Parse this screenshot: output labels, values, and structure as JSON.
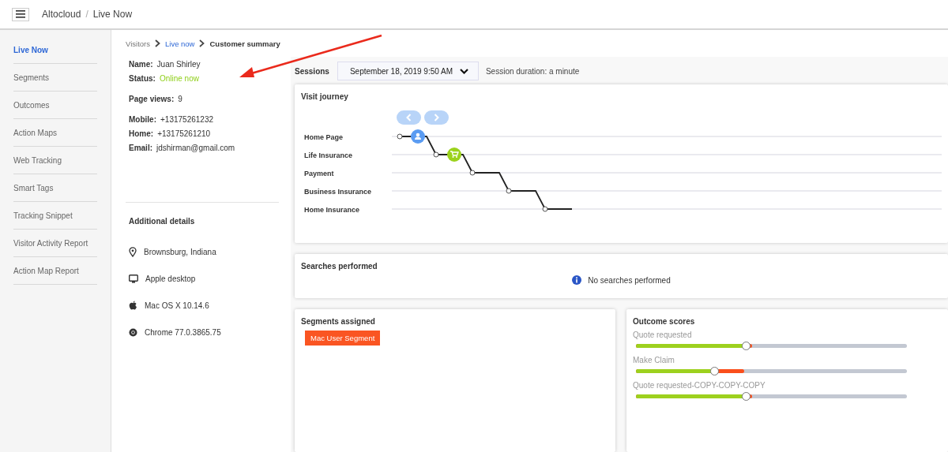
{
  "header": {
    "app": "Altocloud",
    "separator": "/",
    "page": "Live Now"
  },
  "sidebar": {
    "items": [
      {
        "label": "Live Now",
        "selected": true
      },
      {
        "label": "Segments",
        "selected": false
      },
      {
        "label": "Outcomes",
        "selected": false
      },
      {
        "label": "Action Maps",
        "selected": false
      },
      {
        "label": "Web Tracking",
        "selected": false
      },
      {
        "label": "Smart Tags",
        "selected": false
      },
      {
        "label": "Tracking Snippet",
        "selected": false
      },
      {
        "label": "Visitor Activity Report",
        "selected": false
      },
      {
        "label": "Action Map Report",
        "selected": false
      }
    ]
  },
  "breadcrumb": [
    {
      "label": "Visitors",
      "kind": "plain"
    },
    {
      "label": "Live now",
      "kind": "link"
    },
    {
      "label": "Customer summary",
      "kind": "current"
    }
  ],
  "visitor": {
    "groups": [
      [
        {
          "label": "Name:",
          "value": "Juan Shirley",
          "kind": "plain"
        },
        {
          "label": "Status:",
          "value": "Online now",
          "kind": "online"
        }
      ],
      [
        {
          "label": "Page views:",
          "value": "9",
          "kind": "plain"
        }
      ],
      [
        {
          "label": "Mobile:",
          "value": "+13175261232",
          "kind": "plain"
        },
        {
          "label": "Home:",
          "value": "+13175261210",
          "kind": "plain"
        },
        {
          "label": "Email:",
          "value": "jdshirman@gmail.com",
          "kind": "plain"
        }
      ]
    ]
  },
  "additional_details": {
    "title": "Additional details",
    "items": [
      {
        "kind": "location",
        "text": "Brownsburg, Indiana"
      },
      {
        "kind": "device",
        "text": "Apple desktop"
      },
      {
        "kind": "os",
        "text": "Mac OS X 10.14.6"
      },
      {
        "kind": "browser",
        "text": "Chrome 77.0.3865.75"
      }
    ]
  },
  "sessions": {
    "label": "Sessions",
    "value": "September 18, 2019 9:50 AM",
    "duration": "Session duration: a minute"
  },
  "visit_journey": {
    "title": "Visit journey",
    "stages": [
      {
        "label": "Home Page",
        "kind": "visitor"
      },
      {
        "label": "Life Insurance",
        "kind": "cart"
      },
      {
        "label": "Payment",
        "kind": "step"
      },
      {
        "label": "Business Insurance",
        "kind": "step"
      },
      {
        "label": "Home Insurance",
        "kind": "step"
      }
    ]
  },
  "searches": {
    "title": "Searches performed",
    "message": "No searches performed"
  },
  "segments": {
    "title": "Segments assigned",
    "tags": [
      "Mac User Segment"
    ]
  },
  "outcomes": {
    "title": "Outcome scores",
    "items": [
      {
        "name": "Quote requested",
        "level": 0.405,
        "target": {
          "level": 0.43
        }
      },
      {
        "name": "Make Claim",
        "level": 0.29,
        "target": {
          "level": 0.4
        }
      },
      {
        "name": "Quote requested-COPY-COPY-COPY",
        "level": 0.405,
        "target": {
          "level": 0.43
        }
      }
    ]
  }
}
